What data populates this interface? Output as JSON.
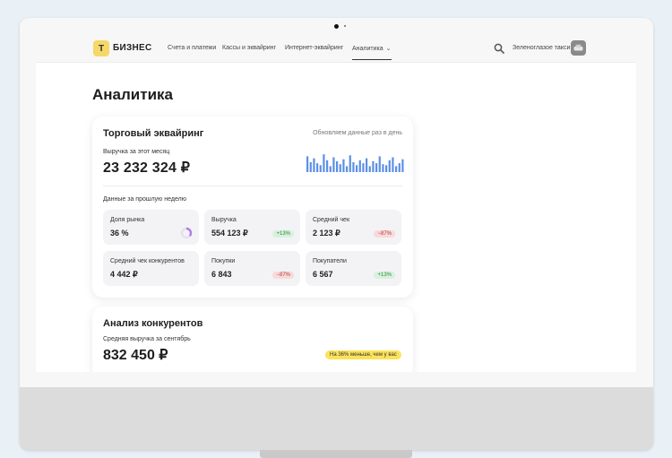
{
  "colors": {
    "accent_yellow": "#f5d867",
    "bar_blue": "#5b8fe6",
    "positive": "#2c8a42",
    "negative": "#b83a3a",
    "highlight": "#fbe25a"
  },
  "header": {
    "logo_letter": "Т",
    "logo_text": "БИЗНЕС",
    "nav": [
      {
        "label": "Счета и платежи"
      },
      {
        "label": "Кассы и эквайринг"
      },
      {
        "label": "Интернет-эквайринг"
      },
      {
        "label": "Аналитика"
      }
    ],
    "search_icon": "search-icon",
    "company_name": "Зеленоглазое такси"
  },
  "page": {
    "title": "Аналитика"
  },
  "acquiring": {
    "title": "Торговый эквайринг",
    "note": "Обновляем данные раз в день",
    "revenue_label": "Выручка за этот месяц",
    "revenue_value": "23 232 324 ₽",
    "bar_levels": [
      0.8,
      0.5,
      0.7,
      0.45,
      0.35,
      0.9,
      0.6,
      0.3,
      0.75,
      0.55,
      0.4,
      0.65,
      0.3,
      0.85,
      0.5,
      0.35,
      0.6,
      0.45,
      0.7,
      0.3,
      0.55,
      0.45,
      0.8,
      0.4,
      0.35,
      0.6,
      0.75,
      0.3,
      0.45,
      0.65
    ],
    "week_label": "Данные за прошлую неделю",
    "tiles": [
      {
        "label": "Доля рынка",
        "value": "36 %",
        "badge": "",
        "ring_fraction": 0.36
      },
      {
        "label": "Выручка",
        "value": "554 123 ₽",
        "badge": "+13%",
        "trend": "up"
      },
      {
        "label": "Средний чек",
        "value": "2 123 ₽",
        "badge": "−87%",
        "trend": "down"
      },
      {
        "label": "Средний чек конкурентов",
        "value": "4 442 ₽",
        "badge": ""
      },
      {
        "label": "Покупки",
        "value": "6 843",
        "badge": "−87%",
        "trend": "down"
      },
      {
        "label": "Покупатели",
        "value": "6 567",
        "badge": "+13%",
        "trend": "up"
      }
    ]
  },
  "competitors": {
    "title": "Анализ конкурентов",
    "avg_label": "Средняя выручка за сентябрь",
    "avg_value": "832 450 ₽",
    "badge": "На 36% меньше, чем у вас"
  }
}
